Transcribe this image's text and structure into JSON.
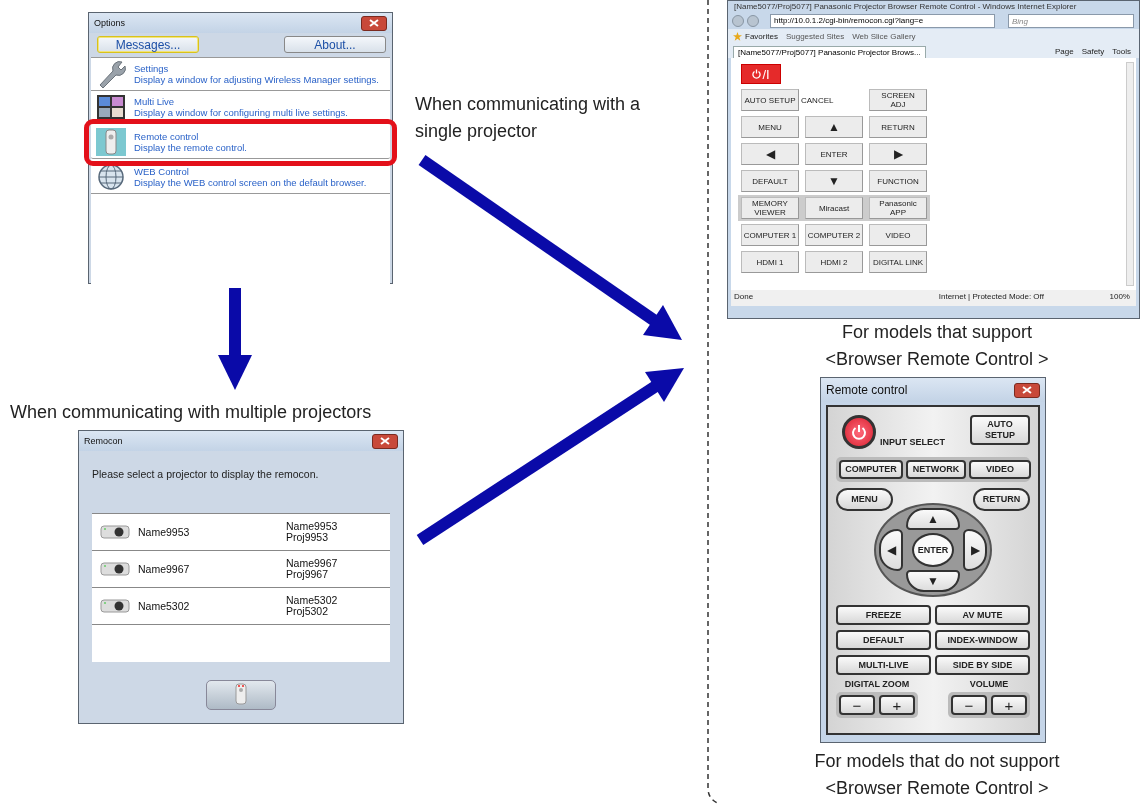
{
  "captions": {
    "single": "When communicating with a single projector",
    "multiple": "When communicating with multiple projectors",
    "supported": [
      "For models that support",
      "<Browser Remote Control >"
    ],
    "unsupported": [
      "For models that do not support",
      "<Browser Remote Control >"
    ]
  },
  "options_window": {
    "title": "Options",
    "buttons": [
      {
        "label": "Messages...",
        "selected": true
      },
      {
        "label": "About...",
        "selected": false
      }
    ],
    "items": [
      {
        "kind": "wrench",
        "title": "Settings",
        "description": "Display a window for adjusting Wireless Manager settings.",
        "highlighted": false
      },
      {
        "kind": "multilive",
        "title": "Multi Live",
        "description": "Display a window for configuring multi live settings.",
        "highlighted": false
      },
      {
        "kind": "remote",
        "title": "Remote control",
        "description": "Display the remote control.",
        "highlighted": true
      },
      {
        "kind": "globe",
        "title": "WEB Control",
        "description": "Display the WEB control screen on the default browser.",
        "highlighted": false
      }
    ]
  },
  "remocon_window": {
    "title": "Remocon",
    "prompt": "Please select a projector to display the remocon.",
    "rows": [
      {
        "name": "Name9953",
        "detail": [
          "Name9953",
          "Proj9953"
        ]
      },
      {
        "name": "Name9967",
        "detail": [
          "Name9967",
          "Proj9967"
        ]
      },
      {
        "name": "Name5302",
        "detail": [
          "Name5302",
          "Proj5302"
        ]
      }
    ]
  },
  "browser": {
    "title": "[Name5077/Proj5077] Panasonic Projector Browser Remote Control - Windows Internet Explorer",
    "address": "http://10.0.1.2/cgi-bin/remocon.cgi?lang=e",
    "search": {
      "placeholder": "Bing"
    },
    "favorites": "Favorites",
    "links": [
      "Suggested Sites",
      "Web Slice Gallery"
    ],
    "tab": "[Name5077/Proj5077] Panasonic Projector Brows...",
    "commands": [
      "Page",
      "Safety",
      "Tools"
    ],
    "power_label": "/I",
    "rows": [
      {
        "grouped": false,
        "cells": [
          {
            "kind": "button",
            "label": "AUTO SETUP"
          },
          {
            "kind": "label",
            "label": "CANCEL"
          },
          {
            "kind": "button",
            "label": "SCREEN\nADJ"
          }
        ]
      },
      {
        "grouped": false,
        "cells": [
          {
            "kind": "button",
            "label": "MENU"
          },
          {
            "kind": "arrow",
            "label": "▲"
          },
          {
            "kind": "button",
            "label": "RETURN"
          }
        ]
      },
      {
        "grouped": false,
        "cells": [
          {
            "kind": "arrow",
            "label": "◀"
          },
          {
            "kind": "button",
            "label": "ENTER"
          },
          {
            "kind": "arrow",
            "label": "▶"
          }
        ]
      },
      {
        "grouped": false,
        "cells": [
          {
            "kind": "button",
            "label": "DEFAULT"
          },
          {
            "kind": "arrow",
            "label": "▼"
          },
          {
            "kind": "button",
            "label": "FUNCTION"
          }
        ]
      },
      {
        "grouped": true,
        "cells": [
          {
            "kind": "button",
            "label": "MEMORY\nVIEWER"
          },
          {
            "kind": "button",
            "label": "Miracast"
          },
          {
            "kind": "button",
            "label": "Panasonic\nAPP"
          }
        ]
      },
      {
        "grouped": false,
        "cells": [
          {
            "kind": "button",
            "label": "COMPUTER 1"
          },
          {
            "kind": "button",
            "label": "COMPUTER 2"
          },
          {
            "kind": "button",
            "label": "VIDEO"
          }
        ]
      },
      {
        "grouped": false,
        "cells": [
          {
            "kind": "button",
            "label": "HDMI 1"
          },
          {
            "kind": "button",
            "label": "HDMI 2"
          },
          {
            "kind": "button",
            "label": "DIGITAL LINK"
          }
        ]
      }
    ],
    "status": {
      "left": "Done",
      "zone": "Internet | Protected Mode: Off",
      "zoom": "100%"
    }
  },
  "remote_window": {
    "title": "Remote control",
    "input_select": "INPUT SELECT",
    "auto_setup": "AUTO\nSETUP",
    "inputs": [
      "COMPUTER",
      "NETWORK",
      "VIDEO"
    ],
    "menu": "MENU",
    "return": "RETURN",
    "dpad": {
      "up": "▲",
      "left": "◀",
      "center": "ENTER",
      "right": "▶",
      "down": "▼"
    },
    "function_buttons": [
      "FREEZE",
      "AV MUTE",
      "DEFAULT",
      "INDEX-WINDOW",
      "MULTI-LIVE",
      "SIDE BY SIDE"
    ],
    "adjusters": [
      {
        "label": "DIGITAL ZOOM",
        "minus": "−",
        "plus": "+"
      },
      {
        "label": "VOLUME",
        "minus": "−",
        "plus": "+"
      }
    ]
  }
}
